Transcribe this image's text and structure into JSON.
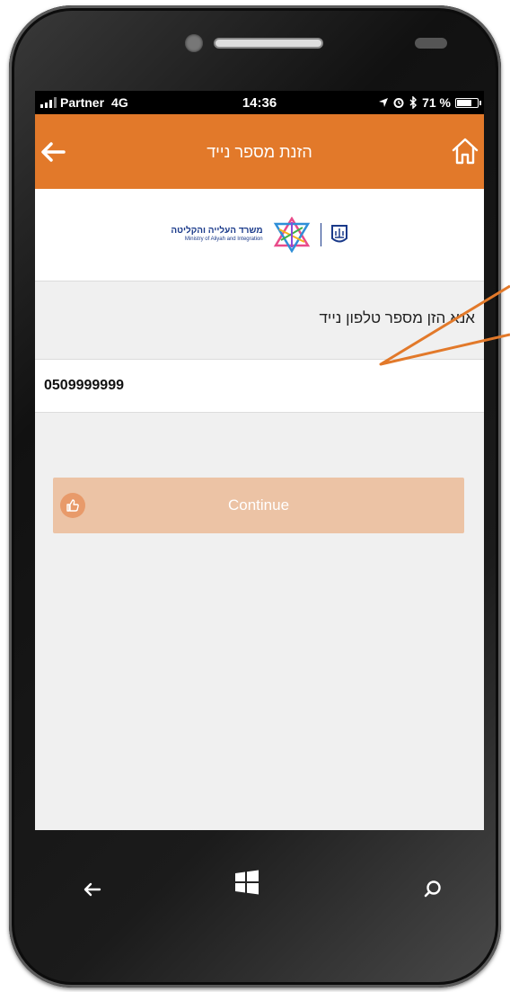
{
  "status_bar": {
    "carrier": "Partner",
    "network": "4G",
    "time": "14:36",
    "battery": "71 %",
    "battery_level": 0.71
  },
  "app_bar": {
    "title": "הזנת מספר נייד",
    "back_icon": "arrow-left-icon",
    "home_icon": "home-icon",
    "background": "#e2792a"
  },
  "logo": {
    "hebrew": "משרד העלייה והקליטה",
    "english": "Ministry of Aliyah and Integration"
  },
  "form": {
    "prompt": "אנא הזן מספר טלפון נייד",
    "phone_value": "0509999999",
    "continue_label": "Continue",
    "continue_icon": "thumbs-up-icon"
  },
  "colors": {
    "accent": "#e2792a",
    "button_disabled": "#ecc3a5",
    "brand_blue": "#1a3a8a"
  },
  "phone_nav": {
    "back_icon": "arrow-left-icon",
    "home_icon": "windows-icon",
    "search_icon": "search-icon"
  }
}
